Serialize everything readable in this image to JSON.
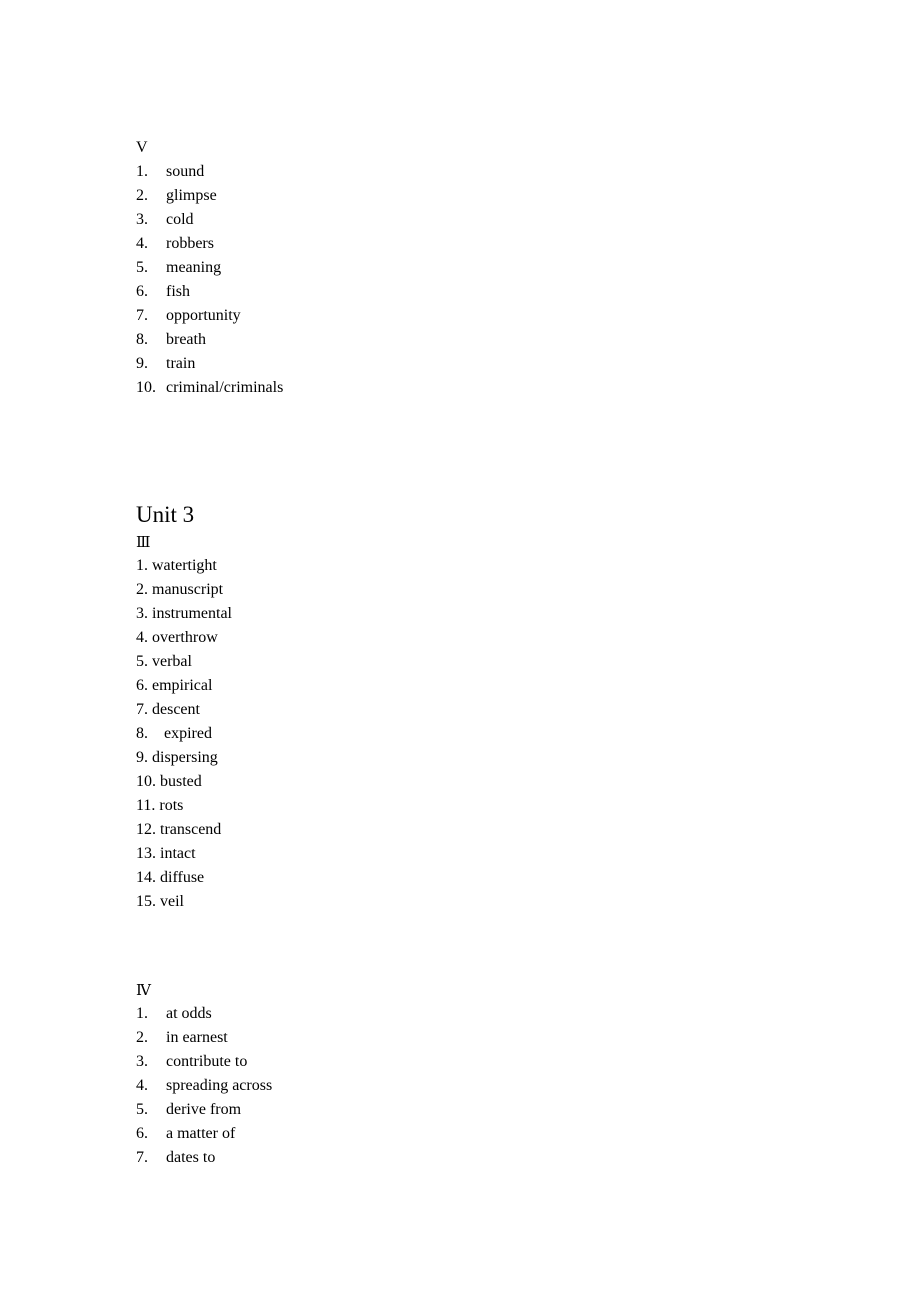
{
  "document": {
    "background_color": "#ffffff",
    "text_color": "#000000"
  },
  "sections": {
    "section_v": {
      "marker": "V",
      "items": [
        {
          "num": "1.",
          "text": "sound"
        },
        {
          "num": "2.",
          "text": "glimpse"
        },
        {
          "num": "3.",
          "text": "cold"
        },
        {
          "num": "4.",
          "text": "robbers"
        },
        {
          "num": "5.",
          "text": "meaning"
        },
        {
          "num": "6.",
          "text": "fish"
        },
        {
          "num": "7.",
          "text": "opportunity"
        },
        {
          "num": "8.",
          "text": "breath"
        },
        {
          "num": "9.",
          "text": "train"
        },
        {
          "num": "10.",
          "text": "criminal/criminals"
        }
      ]
    },
    "unit_heading": "Unit 3",
    "section_iii": {
      "marker": "Ⅲ",
      "items": [
        {
          "num": "1.",
          "text": " watertight"
        },
        {
          "num": "2.",
          "text": " manuscript"
        },
        {
          "num": "3.",
          "text": " instrumental"
        },
        {
          "num": "4.",
          "text": " overthrow"
        },
        {
          "num": "5.",
          "text": " verbal"
        },
        {
          "num": "6.",
          "text": " empirical"
        },
        {
          "num": "7.",
          "text": " descent"
        },
        {
          "num": "8.",
          "text": "    expired"
        },
        {
          "num": "9.",
          "text": " dispersing"
        },
        {
          "num": "10.",
          "text": " busted"
        },
        {
          "num": "11.",
          "text": " rots"
        },
        {
          "num": "12.",
          "text": " transcend"
        },
        {
          "num": "13.",
          "text": " intact"
        },
        {
          "num": "14.",
          "text": " diffuse"
        },
        {
          "num": "15.",
          "text": " veil"
        }
      ]
    },
    "section_iv": {
      "marker": "Ⅳ",
      "items": [
        {
          "num": "1.",
          "text": "at odds"
        },
        {
          "num": "2.",
          "text": "in earnest"
        },
        {
          "num": "3.",
          "text": "contribute to"
        },
        {
          "num": "4.",
          "text": "spreading across"
        },
        {
          "num": "5.",
          "text": "derive from"
        },
        {
          "num": "6.",
          "text": "a matter of"
        },
        {
          "num": "7.",
          "text": "dates to"
        }
      ]
    }
  }
}
